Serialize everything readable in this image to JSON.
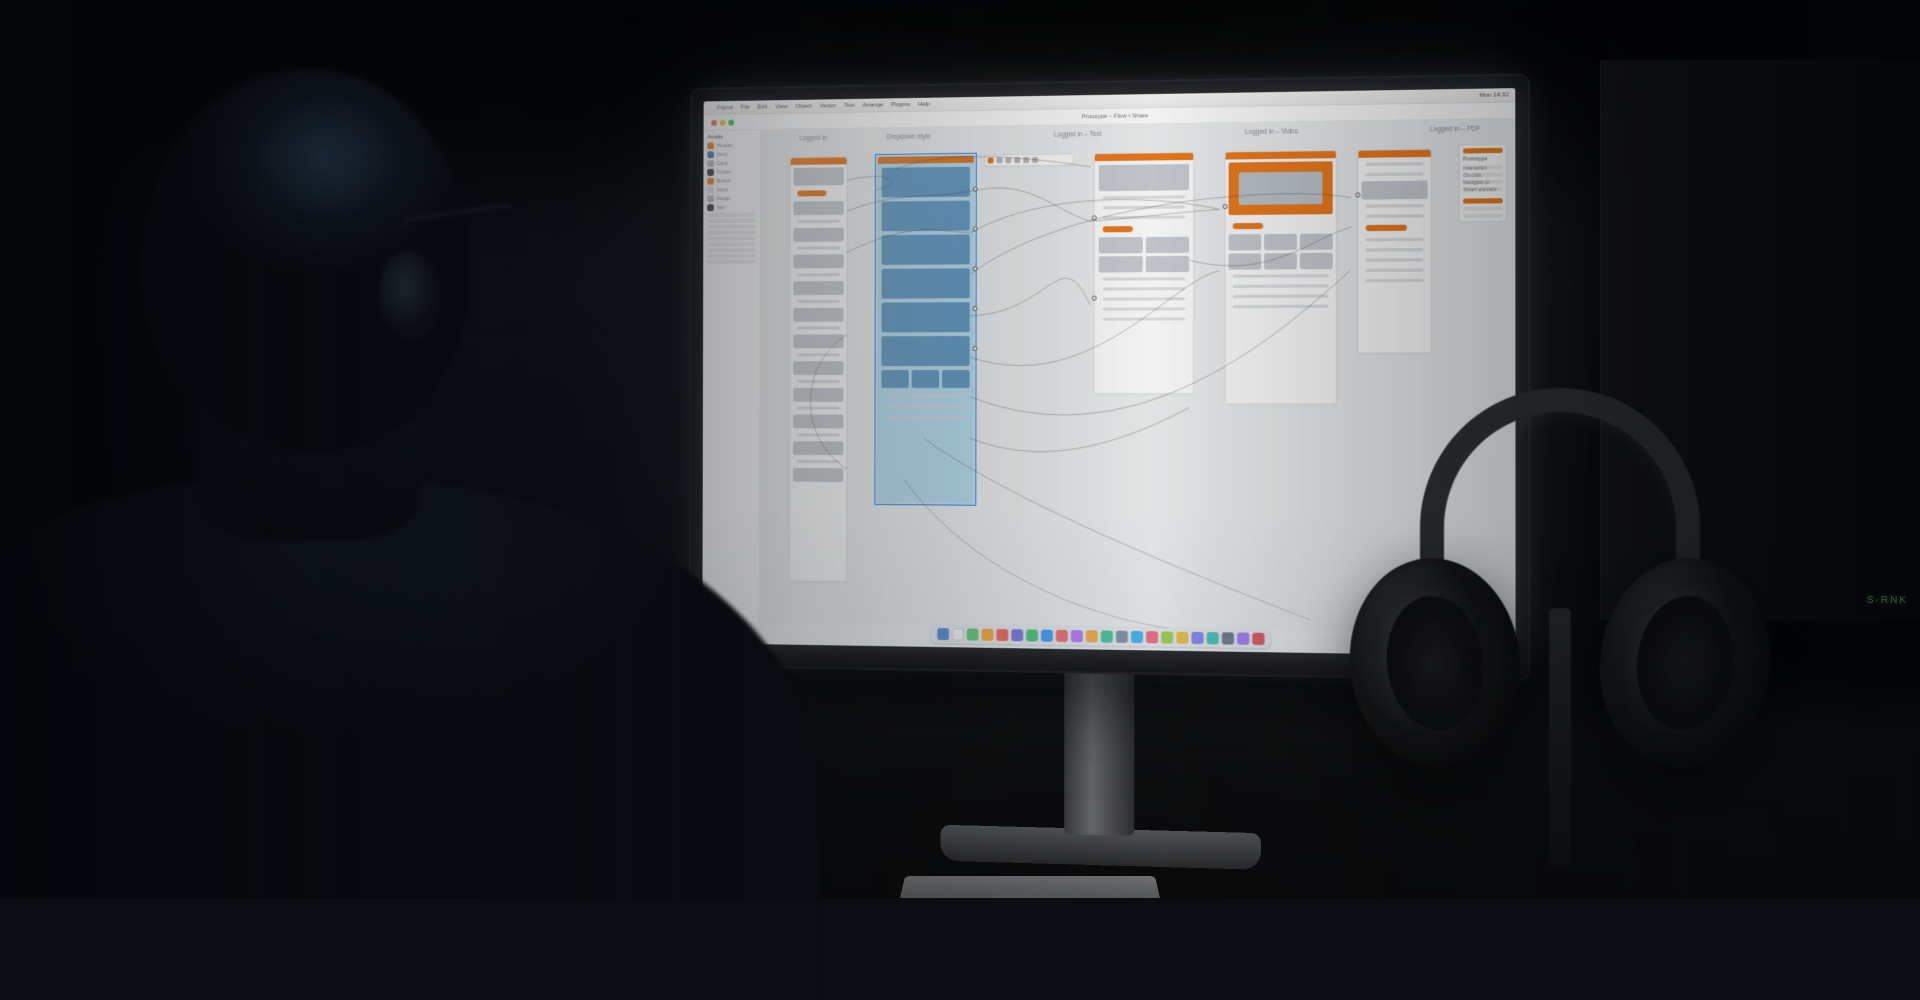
{
  "mac_menubar": {
    "apple_glyph": "",
    "app_name": "Figma",
    "menus": [
      "File",
      "Edit",
      "View",
      "Object",
      "Vector",
      "Text",
      "Arrange",
      "Plugins",
      "Help"
    ],
    "right_status": "Mon 14:32"
  },
  "app": {
    "document_title": "Prototype – Flow  •  Share",
    "left_panel": {
      "section": "Assets",
      "items": [
        {
          "label": "Header",
          "swatch": "or"
        },
        {
          "label": "Hero",
          "swatch": "bl"
        },
        {
          "label": "Card",
          "swatch": "gy"
        },
        {
          "label": "Footer",
          "swatch": "dk"
        },
        {
          "label": "Button",
          "swatch": "or"
        },
        {
          "label": "Input",
          "swatch": "lt"
        },
        {
          "label": "Modal",
          "swatch": "gy"
        },
        {
          "label": "Nav",
          "swatch": "dk"
        }
      ]
    },
    "canvas": {
      "column_labels": [
        "Logged in",
        "Dropdown style",
        "Logged in – Text",
        "Logged in – Video",
        "Logged in – PDF"
      ]
    },
    "float_panel": {
      "title": "Prototype",
      "rows": [
        "Interaction",
        "On click",
        "Navigate to",
        "Smart animate"
      ]
    }
  },
  "dock_colors": [
    "#2f6fd1",
    "#ffffff",
    "#34c759",
    "#ff9500",
    "#ff3b30",
    "#5856d6",
    "#1db954",
    "#0a84ff",
    "#ef4444",
    "#a855f7",
    "#f59e0b",
    "#10b981",
    "#64748b",
    "#0ea5e9",
    "#f43f5e",
    "#84cc16",
    "#eab308",
    "#6366f1",
    "#14b8a6",
    "#475569",
    "#8b5cf6",
    "#dc2626"
  ],
  "colors": {
    "accent_orange": "#ee7b1c",
    "selection_blue": "#1e90ff",
    "canvas_bg": "#eef0f1"
  },
  "speaker_led": "S-RNK"
}
